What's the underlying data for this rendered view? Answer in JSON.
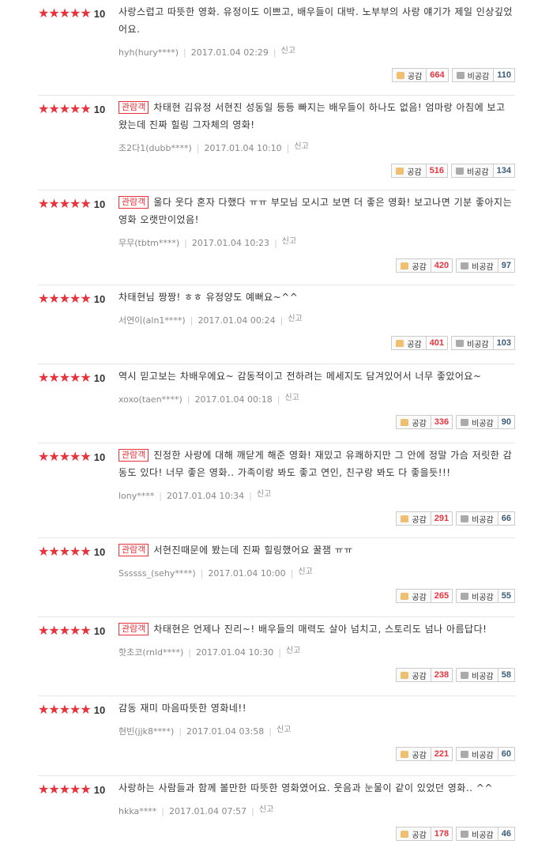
{
  "labels": {
    "report": "신고",
    "like": "공감",
    "dislike": "비공감",
    "audience_badge": "관람객",
    "star": "★"
  },
  "reviews": [
    {
      "score": "10",
      "badge": false,
      "text": "사랑스럽고 따뜻한 영화. 유정이도 이쁘고, 배우들이 대박. 노부부의 사랑 얘기가 제일 인상깊었어요.",
      "user": "hyh(hury****)",
      "date": "2017.01.04 02:29",
      "likes": "664",
      "dislikes": "110"
    },
    {
      "score": "10",
      "badge": true,
      "text": "차태현 김유정 서현진 성동일 등등 빠지는 배우들이 하나도 없음! 엄마랑 아침에 보고 왔는데 진짜 힐링 그자체의 영화!",
      "user": "조2다1(dubb****)",
      "date": "2017.01.04 10:10",
      "likes": "516",
      "dislikes": "134"
    },
    {
      "score": "10",
      "badge": true,
      "text": "울다 웃다 혼자 다했다 ㅠㅠ 부모님 모시고 보면 더 좋은 영화! 보고나면 기분 좋아지는 영화 오랫만이었음!",
      "user": "무무(tbtm****)",
      "date": "2017.01.04 10:23",
      "likes": "420",
      "dislikes": "97"
    },
    {
      "score": "10",
      "badge": false,
      "text": "차태현님 짱짱! ㅎㅎ 유정양도 예뻐요~^^",
      "user": "서연이(aln1****)",
      "date": "2017.01.04 00:24",
      "likes": "401",
      "dislikes": "103"
    },
    {
      "score": "10",
      "badge": false,
      "text": "역시 믿고보는 차배우에요~ 감동적이고 전하려는 메세지도 담겨있어서 너무 좋았어요~",
      "user": "xoxo(taen****)",
      "date": "2017.01.04 00:18",
      "likes": "336",
      "dislikes": "90"
    },
    {
      "score": "10",
      "badge": true,
      "text": "진정한 사랑에 대해 깨닫게 해준 영화! 재밌고 유쾌하지만 그 안에 정말 가슴 저릿한 감동도 있다! 너무 좋은 영화.. 가족이랑 봐도 좋고 연인, 친구랑 봐도 다 좋을듯!!!",
      "user": "lony****",
      "date": "2017.01.04 10:34",
      "likes": "291",
      "dislikes": "66"
    },
    {
      "score": "10",
      "badge": true,
      "text": "서현진때문에 봤는데 진짜 힐링했어요 꿀잼 ㅠㅠ",
      "user": "Ssssss_(sehy****)",
      "date": "2017.01.04 10:00",
      "likes": "265",
      "dislikes": "55"
    },
    {
      "score": "10",
      "badge": true,
      "text": "차태현은 언제나 진리~! 배우들의 매력도 살아 넘치고, 스토리도 넘나 아름답다!",
      "user": "핫초코(rnld****)",
      "date": "2017.01.04 10:30",
      "likes": "238",
      "dislikes": "58"
    },
    {
      "score": "10",
      "badge": false,
      "text": "감동 재미 마음따뜻한 영화네!!",
      "user": "현빈(jjk8****)",
      "date": "2017.01.04 03:58",
      "likes": "221",
      "dislikes": "60"
    },
    {
      "score": "10",
      "badge": false,
      "text": "사랑하는 사람들과 함께 볼만한 따뜻한 영화였어요. 웃음과 눈물이 같이 있었던 영화.. ^^",
      "user": "hkka****",
      "date": "2017.01.04 07:57",
      "likes": "178",
      "dislikes": "46"
    }
  ],
  "colors": {
    "star": "#e8323c",
    "like_count": "#e8323c",
    "dislike_count": "#3a5a7a"
  }
}
